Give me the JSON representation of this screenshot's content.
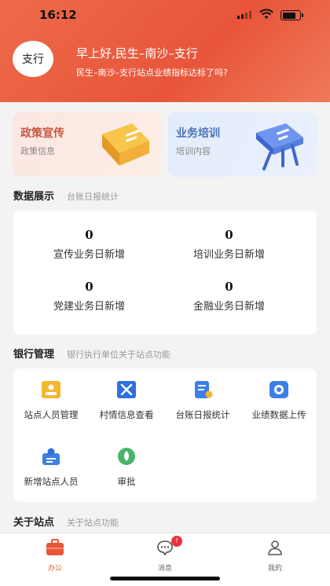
{
  "status_bar": {
    "time": "16:12"
  },
  "header": {
    "avatar_text": "支行",
    "greeting": "早上好,民生–南沙–支行",
    "subtitle": "民生–南沙–支行站点业绩指标达标了吗?"
  },
  "promos": [
    {
      "title": "政策宣传",
      "subtitle": "政策信息"
    },
    {
      "title": "业务培训",
      "subtitle": "培训内容"
    }
  ],
  "data_section": {
    "title": "数据展示",
    "subtitle": "台账日报统计",
    "stats": [
      {
        "value": "0",
        "label": "宣传业务日新增"
      },
      {
        "value": "0",
        "label": "培训业务日新增"
      },
      {
        "value": "0",
        "label": "党建业务日新增"
      },
      {
        "value": "0",
        "label": "金融业务日新增"
      }
    ]
  },
  "bank_section": {
    "title": "银行管理",
    "subtitle": "银行执行单位关于站点功能",
    "items": [
      {
        "label": "站点人员管理",
        "icon": "id-card-icon",
        "color": "#f4b731"
      },
      {
        "label": "村情信息查看",
        "icon": "tools-icon",
        "color": "#2f6fe0"
      },
      {
        "label": "台账日报统计",
        "icon": "report-icon",
        "color": "#3d7fe8"
      },
      {
        "label": "业绩数据上传",
        "icon": "upload-icon",
        "color": "#3d7fe8"
      },
      {
        "label": "新增站点人员",
        "icon": "add-person-icon",
        "color": "#3d7fe8"
      },
      {
        "label": "审批",
        "icon": "approve-icon",
        "color": "#4cb36a"
      }
    ]
  },
  "about_section": {
    "title": "关于站点",
    "subtitle": "关于站点功能"
  },
  "tabbar": {
    "tabs": [
      {
        "label": "办公",
        "icon": "briefcase-icon",
        "active": true
      },
      {
        "label": "消息",
        "icon": "chat-icon",
        "badge": "!"
      },
      {
        "label": "我的",
        "icon": "user-icon"
      }
    ]
  },
  "colors": {
    "accent": "#e8553a",
    "background": "#f3f3f3"
  }
}
